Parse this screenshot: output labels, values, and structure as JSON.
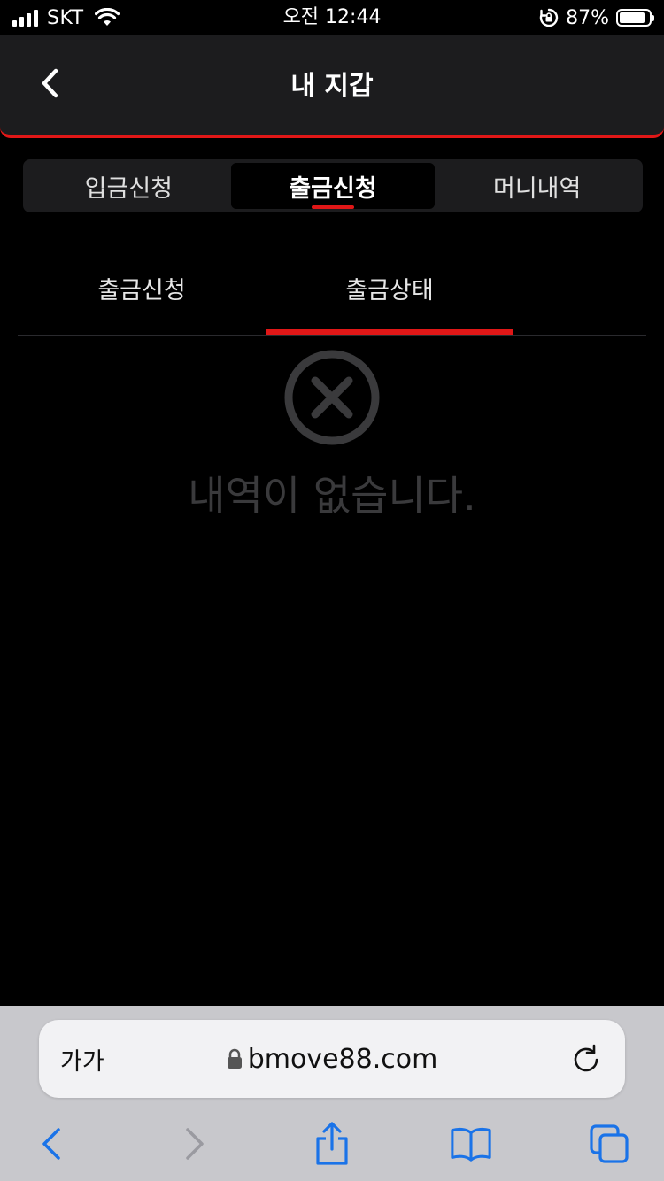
{
  "status_bar": {
    "carrier": "SKT",
    "time": "오전 12:44",
    "battery": "87%",
    "battery_level": 0.87
  },
  "header": {
    "title": "내 지갑"
  },
  "segment_tabs": [
    {
      "label": "입금신청",
      "active": false
    },
    {
      "label": "출금신청",
      "active": true
    },
    {
      "label": "머니내역",
      "active": false
    }
  ],
  "sub_tabs": [
    {
      "label": "출금신청",
      "active": false
    },
    {
      "label": "출금상태",
      "active": true
    }
  ],
  "empty_state": {
    "message": "내역이 없습니다."
  },
  "browser": {
    "text_size_label": "가가",
    "url": "bmove88.com"
  },
  "colors": {
    "accent": "#e01717",
    "header_bg": "#1c1c1e",
    "empty_text": "#3a3a3c",
    "toolbar_icon": "#1a73e8"
  },
  "icons": [
    "back-chevron-icon",
    "close-circle-icon",
    "lock-icon",
    "reload-icon",
    "back-arrow-icon",
    "forward-arrow-icon",
    "share-icon",
    "bookmarks-icon",
    "tabs-icon"
  ]
}
